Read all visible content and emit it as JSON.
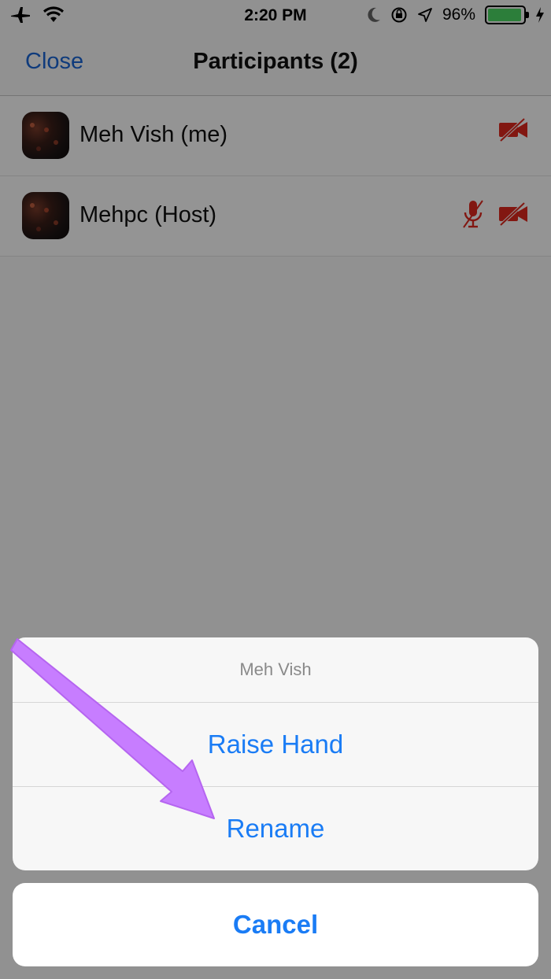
{
  "status_bar": {
    "time": "2:20 PM",
    "battery_percent": "96%",
    "battery_level": 0.96,
    "icons": [
      "airplane-icon",
      "wifi-icon",
      "moon-icon",
      "rotation-lock-icon",
      "location-icon",
      "battery-icon",
      "charging-icon"
    ]
  },
  "nav": {
    "close_label": "Close",
    "title": "Participants (2)"
  },
  "participants": [
    {
      "name": "Meh Vish (me)",
      "muted": false,
      "video_off": true
    },
    {
      "name": "Mehpc (Host)",
      "muted": true,
      "video_off": true
    }
  ],
  "action_sheet": {
    "title": "Meh Vish",
    "actions": [
      "Raise Hand",
      "Rename"
    ],
    "cancel_label": "Cancel"
  },
  "colors": {
    "link_blue": "#1a66d6",
    "action_blue": "#1a7cf5",
    "muted_red": "#e0281e",
    "annotation_arrow": "#c77dff"
  }
}
